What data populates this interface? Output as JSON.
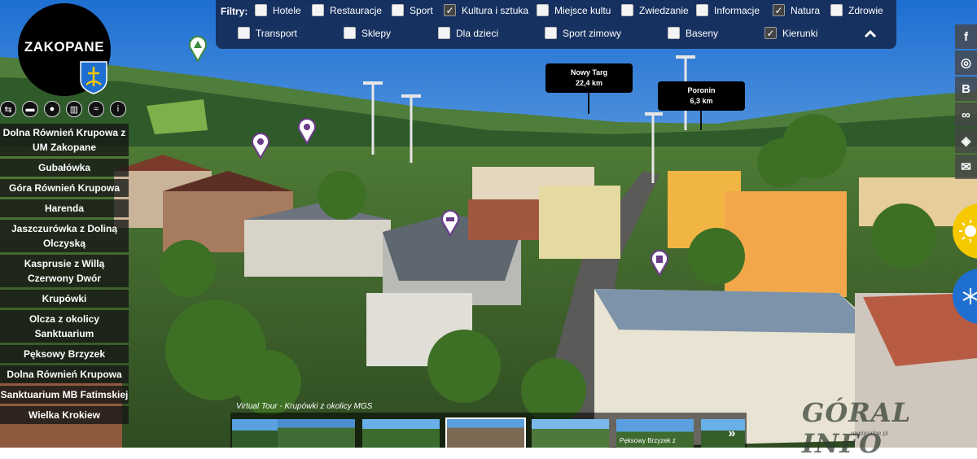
{
  "filters": {
    "label": "Filtry:",
    "row1": [
      {
        "label": "Hotele",
        "checked": false
      },
      {
        "label": "Restauracje",
        "checked": false
      },
      {
        "label": "Sport",
        "checked": false
      },
      {
        "label": "Kultura i sztuka",
        "checked": true
      },
      {
        "label": "Miejsce kultu",
        "checked": false
      },
      {
        "label": "Zwiedzanie",
        "checked": false
      },
      {
        "label": "Informacje",
        "checked": false
      },
      {
        "label": "Natura",
        "checked": true
      },
      {
        "label": "Zdrowie",
        "checked": false
      }
    ],
    "row2": [
      {
        "label": "Transport",
        "checked": false
      },
      {
        "label": "Sklepy",
        "checked": false
      },
      {
        "label": "Dla dzieci",
        "checked": false
      },
      {
        "label": "Sport zimowy",
        "checked": false
      },
      {
        "label": "Baseny",
        "checked": false
      },
      {
        "label": "Kierunki",
        "checked": true
      }
    ],
    "check_mark": "✓",
    "collapse_icon": "chevron-up-icon"
  },
  "logo": {
    "text": "ZAKOPANE"
  },
  "category_icons": [
    "signpost-icon",
    "bed-icon",
    "food-icon",
    "museum-icon",
    "swim-icon",
    "info-icon"
  ],
  "category_glyphs": [
    "⇆",
    "▬",
    "●",
    "▥",
    "≈",
    "i"
  ],
  "locations": [
    "Dolna Równień Krupowa z UM Zakopane",
    "Gubałówka",
    "Góra Równień Krupowa",
    "Harenda",
    "Jaszczurówka z Doliną Olczyską",
    "Kasprusie z Willą Czerwony Dwór",
    "Krupówki",
    "Olcza z okolicy Sanktuarium",
    "Pęksowy Brzyzek",
    "Dolna Równień Krupowa",
    "Sanktuarium MB Fatimskiej",
    "Wielka Krokiew"
  ],
  "callouts": [
    {
      "name": "Nowy Targ",
      "distance": "22,4 km"
    },
    {
      "name": "Poronin",
      "distance": "6,3 km"
    }
  ],
  "social": {
    "items": [
      "facebook-icon",
      "instagram-icon",
      "blog-icon",
      "tripadvisor-icon",
      "map-icon",
      "mail-icon"
    ],
    "glyphs": [
      "f",
      "◎",
      "B",
      "∞",
      "◈",
      "✉"
    ]
  },
  "season": {
    "summer": "sun-icon",
    "winter": "snowflake-icon"
  },
  "tour": {
    "caption": "Virtual Tour - Krupówki z okolicy MGS",
    "thumb_labels": [
      "",
      "",
      "",
      "",
      "",
      "Pęksowy Brzyzek z",
      ""
    ],
    "selected_index": 3
  },
  "watermark": {
    "text": "GÓRAL INFO",
    "sub": "regionalne.pl"
  },
  "colors": {
    "filterbar": "#142850",
    "sky": "#3f8fd8",
    "accent": "#f5c800",
    "winter": "#1f6fd0"
  }
}
